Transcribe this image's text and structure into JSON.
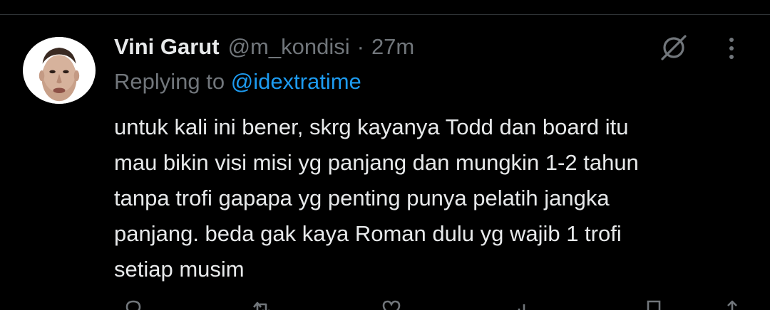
{
  "tweet": {
    "author": {
      "display_name": "Vini Garut",
      "handle": "@m_kondisi"
    },
    "separator": "·",
    "time": "27m",
    "reply": {
      "prefix": "Replying to",
      "mention": "@idextratime"
    },
    "body_lines": [
      "untuk kali ini bener, skrg kayanya Todd dan board itu",
      "mau bikin visi misi yg panjang dan mungkin 1-2 tahun",
      "tanpa trofi gapapa yg penting punya pelatih jangka",
      "panjang. beda gak kaya Roman dulu yg wajib 1 trofi",
      "setiap musim"
    ]
  },
  "icons": {
    "grok": "grok-slash-circle-icon",
    "more": "more-vertical-icon",
    "actions": [
      "reply-icon",
      "retweet-icon",
      "like-icon",
      "views-icon",
      "bookmark-icon",
      "share-icon"
    ]
  },
  "colors": {
    "background": "#000000",
    "text_primary": "#e7e9ea",
    "text_secondary": "#71767b",
    "link": "#1d9bf0",
    "divider": "#2f3336"
  }
}
